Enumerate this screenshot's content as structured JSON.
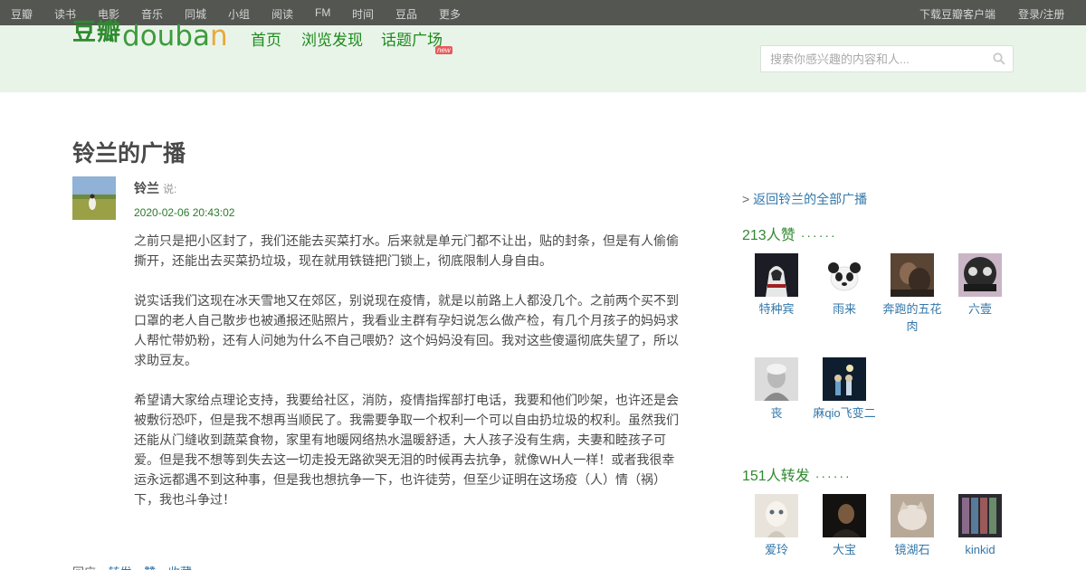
{
  "topbar": {
    "links": [
      "豆瓣",
      "读书",
      "电影",
      "音乐",
      "同城",
      "小组",
      "阅读",
      "FM",
      "时间",
      "豆品",
      "更多"
    ],
    "download": "下载豆瓣客户端",
    "login": "登录/注册"
  },
  "header": {
    "logo_cn": "豆瓣",
    "logo_en_1": "douba",
    "logo_en_2": "n",
    "nav": [
      "首页",
      "浏览发现",
      "话题广场"
    ],
    "new_badge": "new",
    "search_placeholder": "搜索你感兴趣的内容和人..."
  },
  "main": {
    "title": "铃兰的广播",
    "author": "铃兰",
    "author_verb": "说:",
    "timestamp": "2020-02-06 20:43:02",
    "paragraphs": [
      "之前只是把小区封了，我们还能去买菜打水。后来就是单元门都不让出，贴的封条，但是有人偷偷撕开，还能出去买菜扔垃圾，现在就用铁链把门锁上，彻底限制人身自由。",
      "说实话我们这现在冰天雪地又在郊区，别说现在疫情，就是以前路上人都没几个。之前两个买不到口罩的老人自己散步也被通报还贴照片，我看业主群有孕妇说怎么做产检，有几个月孩子的妈妈求人帮忙带奶粉，还有人问她为什么不自己喂奶？这个妈妈没有回。我对这些傻逼彻底失望了，所以求助豆友。",
      "希望请大家给点理论支持，我要给社区，消防，疫情指挥部打电话，我要和他们吵架，也许还是会被敷衍恐吓，但是我不想再当顺民了。我需要争取一个权利一个可以自由扔垃圾的权利。虽然我们还能从门缝收到蔬菜食物，家里有地暖网络热水温暖舒适，大人孩子没有生病，夫妻和睦孩子可爱。但是我不想等到失去这一切走投无路欲哭无泪的时候再去抗争，就像WH人一样！或者我很幸运永远都遇不到这种事，但是我也想抗争一下，也许徒劳，但至少证明在这场疫（人）情（祸）下，我也斗争过！"
    ],
    "actions_label": "回应",
    "actions": [
      "转发",
      "赞",
      "收藏"
    ]
  },
  "sidebar": {
    "back_prefix": ">",
    "back_link": "返回铃兰的全部广播",
    "likes_title": "213人赞",
    "reshares_title": "151人转发",
    "more_dots": "······",
    "likers": [
      "特种宾",
      "雨来",
      "奔跑的五花肉",
      "六壹",
      "丧",
      "麻qio飞变二"
    ],
    "resharers": [
      "爱玲",
      "大宝",
      "镜湖石",
      "kinkid"
    ]
  }
}
